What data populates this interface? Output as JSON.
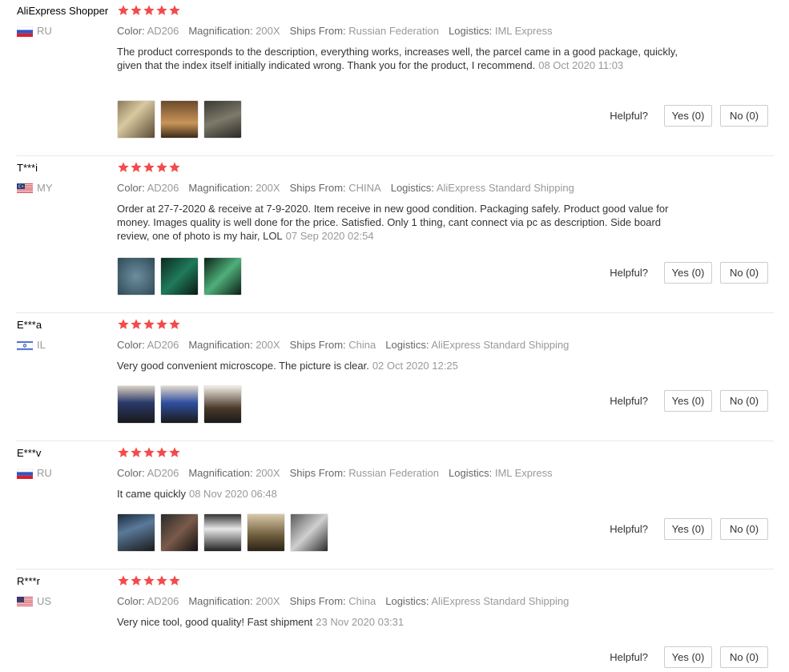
{
  "labels": {
    "color": "Color:",
    "magnification": "Magnification:",
    "ships_from": "Ships From:",
    "logistics": "Logistics:",
    "helpful": "Helpful?",
    "yes": "Yes (0)",
    "no": "No (0)"
  },
  "colors": {
    "star": "#f44a4a",
    "text": "#333333",
    "muted": "#999999"
  },
  "reviews": [
    {
      "user": "AliExpress Shopper",
      "country": "RU",
      "flag": "flag-ru",
      "stars": 5,
      "color": "AD206",
      "magnification": "200X",
      "ships_from": "Russian Federation",
      "logistics": "IML Express",
      "text": "The product corresponds to the description, everything works, increases well, the parcel came in a good package, quickly, given that the index itself initially indicated wrong. Thank you for the product, I recommend.",
      "date": "08 Oct 2020 11:03",
      "photos": 3
    },
    {
      "user": "T***i",
      "country": "MY",
      "flag": "flag-my",
      "stars": 5,
      "color": "AD206",
      "magnification": "200X",
      "ships_from": "CHINA",
      "logistics": "AliExpress Standard Shipping",
      "text": "Order at 27-7-2020 & receive at 7-9-2020. Item receive in new good condition. Packaging safely. Product good value for money. Images quality is well done for the price. Satisfied. Only 1 thing, cant connect via pc as description. Side board review, one of photo is my hair, LOL",
      "date": "07 Sep 2020 02:54",
      "photos": 3
    },
    {
      "user": "E***a",
      "country": "IL",
      "flag": "flag-il",
      "stars": 5,
      "color": "AD206",
      "magnification": "200X",
      "ships_from": "China",
      "logistics": "AliExpress Standard Shipping",
      "text": "Very good convenient microscope. The picture is clear.",
      "date": "02 Oct 2020 12:25",
      "photos": 3
    },
    {
      "user": "E***v",
      "country": "RU",
      "flag": "flag-ru",
      "stars": 5,
      "color": "AD206",
      "magnification": "200X",
      "ships_from": "Russian Federation",
      "logistics": "IML Express",
      "text": "It came quickly",
      "date": "08 Nov 2020 06:48",
      "photos": 5
    },
    {
      "user": "R***r",
      "country": "US",
      "flag": "flag-us",
      "stars": 5,
      "color": "AD206",
      "magnification": "200X",
      "ships_from": "China",
      "logistics": "AliExpress Standard Shipping",
      "text": "Very nice tool, good quality! Fast shipment",
      "date": "23 Nov 2020 03:31",
      "photos": 0
    }
  ]
}
